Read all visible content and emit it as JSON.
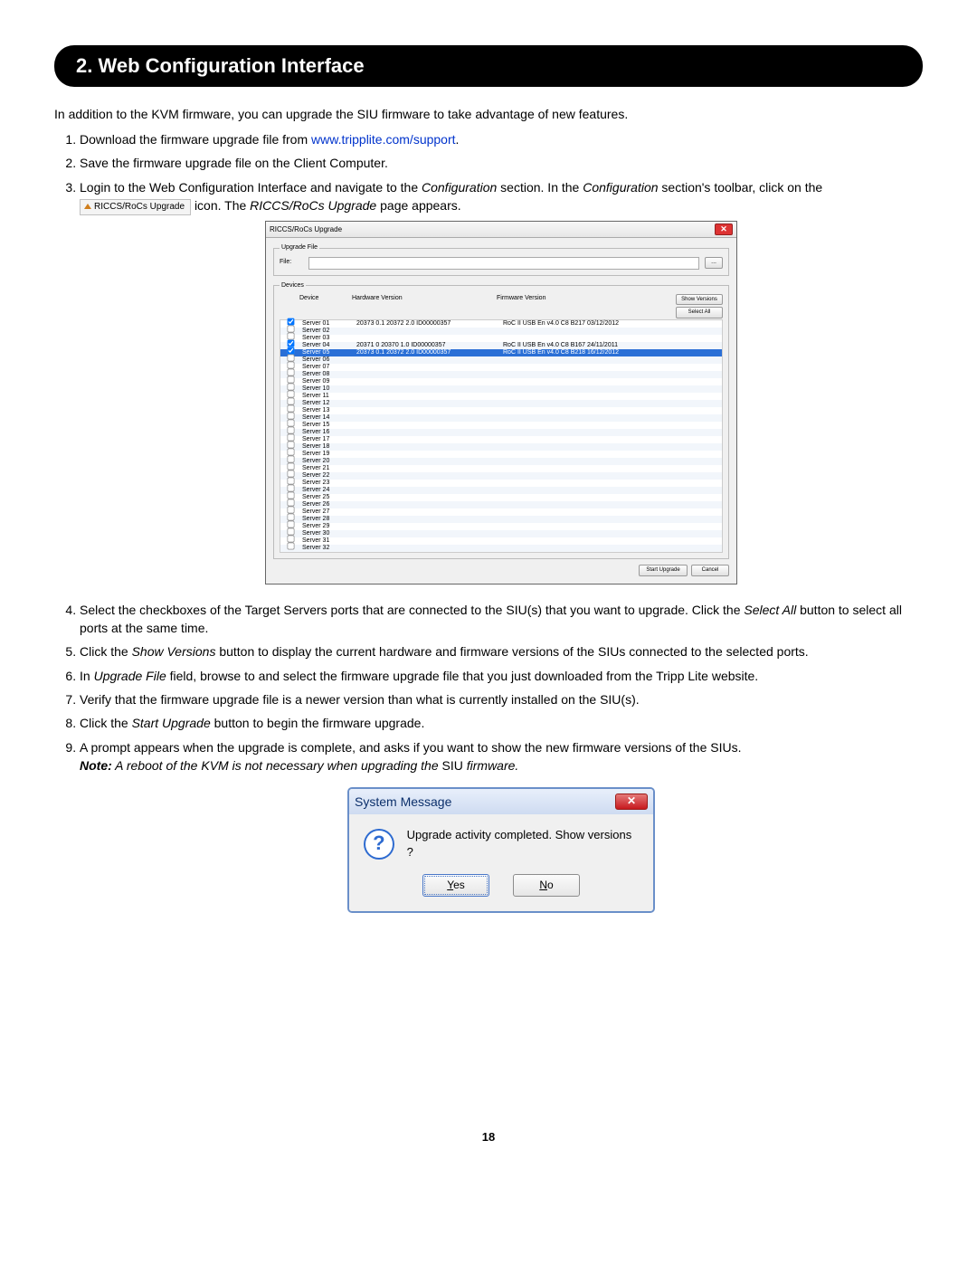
{
  "header": "2. Web Configuration Interface",
  "intro": "In addition to the KVM firmware, you can upgrade the SIU firmware to take advantage of new features.",
  "link_text": "www.tripplite.com/support",
  "steps": {
    "s1a": "Download the firmware upgrade file from ",
    "s1b": ".",
    "s2": "Save the firmware upgrade file on the Client Computer.",
    "s3a": "Login to the Web Configuration Interface and navigate to the ",
    "s3_conf": "Configuration",
    "s3b": " section. In the ",
    "s3c": " section's toolbar, click on the ",
    "s3_icon_label": "RICCS/RoCs Upgrade",
    "s3d": " icon. The ",
    "s3_page": "RICCS/RoCs Upgrade",
    "s3e": " page appears.",
    "s4a": "Select the checkboxes of the Target Servers ports that are connected to the SIU(s) that you want to upgrade. Click the ",
    "s4_btn": "Select All",
    "s4b": " button to select all ports at the same time.",
    "s5a": "Click the ",
    "s5_btn": "Show Versions",
    "s5b": " button to display the current hardware and firmware versions of the SIUs connected to the selected ports.",
    "s6a": "In ",
    "s6_field": "Upgrade File",
    "s6b": " field, browse to and select the firmware upgrade file that you just downloaded from the Tripp Lite website.",
    "s7": "Verify that the firmware upgrade file is a newer version than what is currently installed on the SIU(s).",
    "s8a": "Click the ",
    "s8_btn": "Start Upgrade",
    "s8b": " button to begin the firmware upgrade.",
    "s9a": "A prompt appears when the upgrade is complete, and asks if you want to show the new firmware versions of the SIUs.",
    "s9_note_label": "Note:",
    "s9_note": " A reboot of the KVM is not necessary when upgrading the ",
    "s9_note_siu": "SIU",
    "s9_note_fw": " firmware."
  },
  "shot1": {
    "title": "RICCS/RoCs Upgrade",
    "upgrade_file_legend": "Upgrade File",
    "file_label": "File:",
    "browse_btn": "...",
    "devices_legend": "Devices",
    "col_device": "Device",
    "col_hw": "Hardware Version",
    "col_fw": "Firmware Version",
    "btn_show_versions": "Show Versions",
    "btn_select_all": "Select All",
    "btn_start_upgrade": "Start Upgrade",
    "btn_cancel": "Cancel",
    "rows": [
      {
        "chk": true,
        "device": "Server 01",
        "hw": "20373 0.1 20372 2.0 ID00000357",
        "fw": "RoC II USB En v4.0 C8 B217 03/12/2012"
      },
      {
        "chk": false,
        "device": "Server 02",
        "hw": "",
        "fw": ""
      },
      {
        "chk": false,
        "device": "Server 03",
        "hw": "",
        "fw": ""
      },
      {
        "chk": true,
        "device": "Server 04",
        "hw": "20371 0 20370 1.0 ID00000357",
        "fw": "RoC II USB En v4.0 C8 B167 24/11/2011"
      },
      {
        "chk": true,
        "device": "Server 05",
        "hw": "20373 0.1 20372 2.0 ID00000357",
        "fw": "RoC II USB En v4.0 C8 B218 16/12/2012",
        "sel": true
      },
      {
        "chk": false,
        "device": "Server 06",
        "hw": "",
        "fw": ""
      },
      {
        "chk": false,
        "device": "Server 07",
        "hw": "",
        "fw": ""
      },
      {
        "chk": false,
        "device": "Server 08",
        "hw": "",
        "fw": ""
      },
      {
        "chk": false,
        "device": "Server 09",
        "hw": "",
        "fw": ""
      },
      {
        "chk": false,
        "device": "Server 10",
        "hw": "",
        "fw": ""
      },
      {
        "chk": false,
        "device": "Server 11",
        "hw": "",
        "fw": ""
      },
      {
        "chk": false,
        "device": "Server 12",
        "hw": "",
        "fw": ""
      },
      {
        "chk": false,
        "device": "Server 13",
        "hw": "",
        "fw": ""
      },
      {
        "chk": false,
        "device": "Server 14",
        "hw": "",
        "fw": ""
      },
      {
        "chk": false,
        "device": "Server 15",
        "hw": "",
        "fw": ""
      },
      {
        "chk": false,
        "device": "Server 16",
        "hw": "",
        "fw": ""
      },
      {
        "chk": false,
        "device": "Server 17",
        "hw": "",
        "fw": ""
      },
      {
        "chk": false,
        "device": "Server 18",
        "hw": "",
        "fw": ""
      },
      {
        "chk": false,
        "device": "Server 19",
        "hw": "",
        "fw": ""
      },
      {
        "chk": false,
        "device": "Server 20",
        "hw": "",
        "fw": ""
      },
      {
        "chk": false,
        "device": "Server 21",
        "hw": "",
        "fw": ""
      },
      {
        "chk": false,
        "device": "Server 22",
        "hw": "",
        "fw": ""
      },
      {
        "chk": false,
        "device": "Server 23",
        "hw": "",
        "fw": ""
      },
      {
        "chk": false,
        "device": "Server 24",
        "hw": "",
        "fw": ""
      },
      {
        "chk": false,
        "device": "Server 25",
        "hw": "",
        "fw": ""
      },
      {
        "chk": false,
        "device": "Server 26",
        "hw": "",
        "fw": ""
      },
      {
        "chk": false,
        "device": "Server 27",
        "hw": "",
        "fw": ""
      },
      {
        "chk": false,
        "device": "Server 28",
        "hw": "",
        "fw": ""
      },
      {
        "chk": false,
        "device": "Server 29",
        "hw": "",
        "fw": ""
      },
      {
        "chk": false,
        "device": "Server 30",
        "hw": "",
        "fw": ""
      },
      {
        "chk": false,
        "device": "Server 31",
        "hw": "",
        "fw": ""
      },
      {
        "chk": false,
        "device": "Server 32",
        "hw": "",
        "fw": ""
      }
    ]
  },
  "shot2": {
    "title": "System Message",
    "message": "Upgrade activity completed. Show versions ?",
    "yes": "Yes",
    "no": "No"
  },
  "page_number": "18"
}
